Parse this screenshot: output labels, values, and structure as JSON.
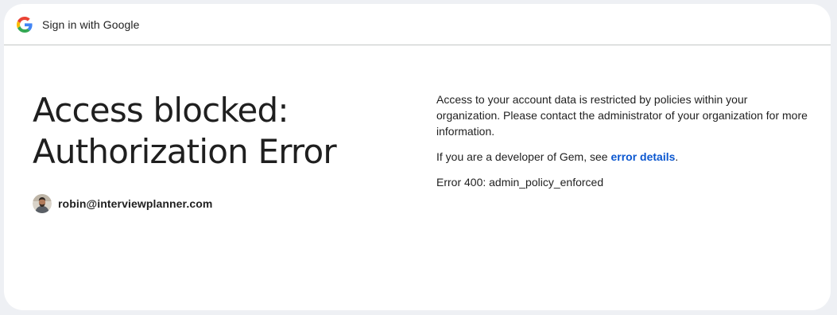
{
  "header": {
    "title": "Sign in with Google",
    "logo_icon": "google-g-icon"
  },
  "main": {
    "title_line1": "Access blocked:",
    "title_line2": "Authorization Error",
    "account": {
      "email": "robin@interviewplanner.com",
      "avatar_icon": "user-avatar"
    }
  },
  "details": {
    "restriction_text": "Access to your account data is restricted by policies within your organization. Please contact the administrator of your organization for more information.",
    "developer_prefix": "If you are a developer of Gem, see ",
    "developer_link": "error details",
    "developer_suffix": ".",
    "error_code": "Error 400: admin_policy_enforced"
  },
  "colors": {
    "background": "#eef0f4",
    "card": "#ffffff",
    "text": "#1f1f1f",
    "link": "#0b57d0",
    "divider": "#c4c7c5"
  }
}
